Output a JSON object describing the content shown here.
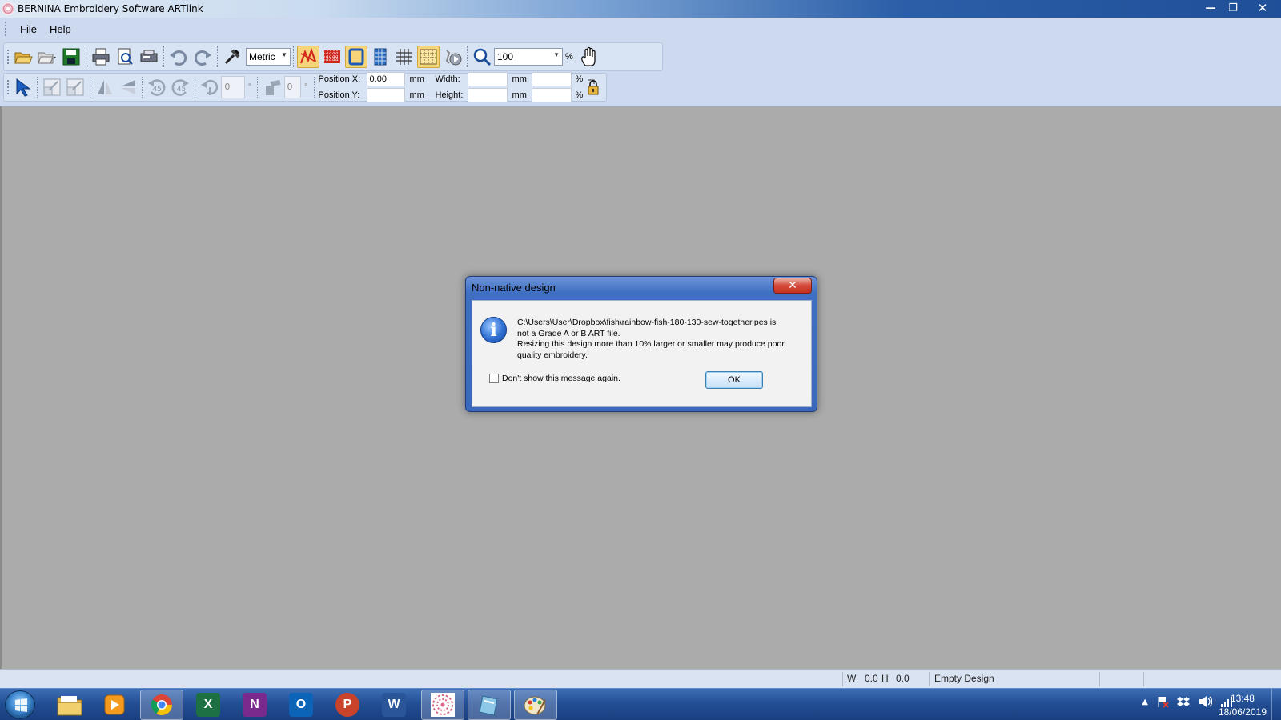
{
  "window": {
    "title": "BERNINA Embroidery Software ARTlink",
    "controls": {
      "minimize": "—",
      "restore": "❐",
      "close": "✕"
    }
  },
  "menu": {
    "items": [
      "File",
      "Help"
    ]
  },
  "toolbar": {
    "units": "Metric",
    "zoom_value": "100",
    "zoom_unit": "%",
    "rotate_value": "0",
    "slant_value": "0",
    "rotate_unit": "°",
    "slant_unit": "°",
    "rotate_left_label": "45",
    "rotate_right_label": "45"
  },
  "properties": {
    "position_x_label": "Position X:",
    "position_x_value": "0.00",
    "position_y_label": "Position Y:",
    "position_y_value": "",
    "width_label": "Width:",
    "width_value": "",
    "height_label": "Height:",
    "height_value": "",
    "unit_mm": "mm",
    "unit_pct": "%",
    "width_pct_value": "",
    "height_pct_value": ""
  },
  "status": {
    "w_label": "W",
    "w_value": "0.0",
    "h_label": "H",
    "h_value": "0.0",
    "design_status": "Empty Design"
  },
  "dialog": {
    "title": "Non-native design",
    "close": "✕",
    "message_line1": "C:\\Users\\User\\Dropbox\\fish\\rainbow-fish-180-130-sew-together.pes is",
    "message_line2": "not a Grade A or B ART file.",
    "message_line3": "Resizing this design more than 10% larger or smaller may produce poor",
    "message_line4": "quality embroidery.",
    "checkbox_label": "Don't show this message again.",
    "ok_label": "OK"
  },
  "taskbar": {
    "apps": [
      "start-button",
      "file-explorer",
      "media-player",
      "chrome",
      "excel",
      "onenote",
      "outlook",
      "powerpoint",
      "word",
      "bernina-artlink",
      "app-blue",
      "paint"
    ],
    "excel_letter": "X",
    "onenote_letter": "N",
    "outlook_letter": "O",
    "powerpoint_letter": "P",
    "word_letter": "W",
    "time": "13:48",
    "date": "18/06/2019",
    "colors": {
      "excel": "#1d7044",
      "onenote": "#7a2a8c",
      "outlook": "#0b64b8",
      "powerpoint": "#c9432a",
      "word": "#2a5699"
    }
  }
}
